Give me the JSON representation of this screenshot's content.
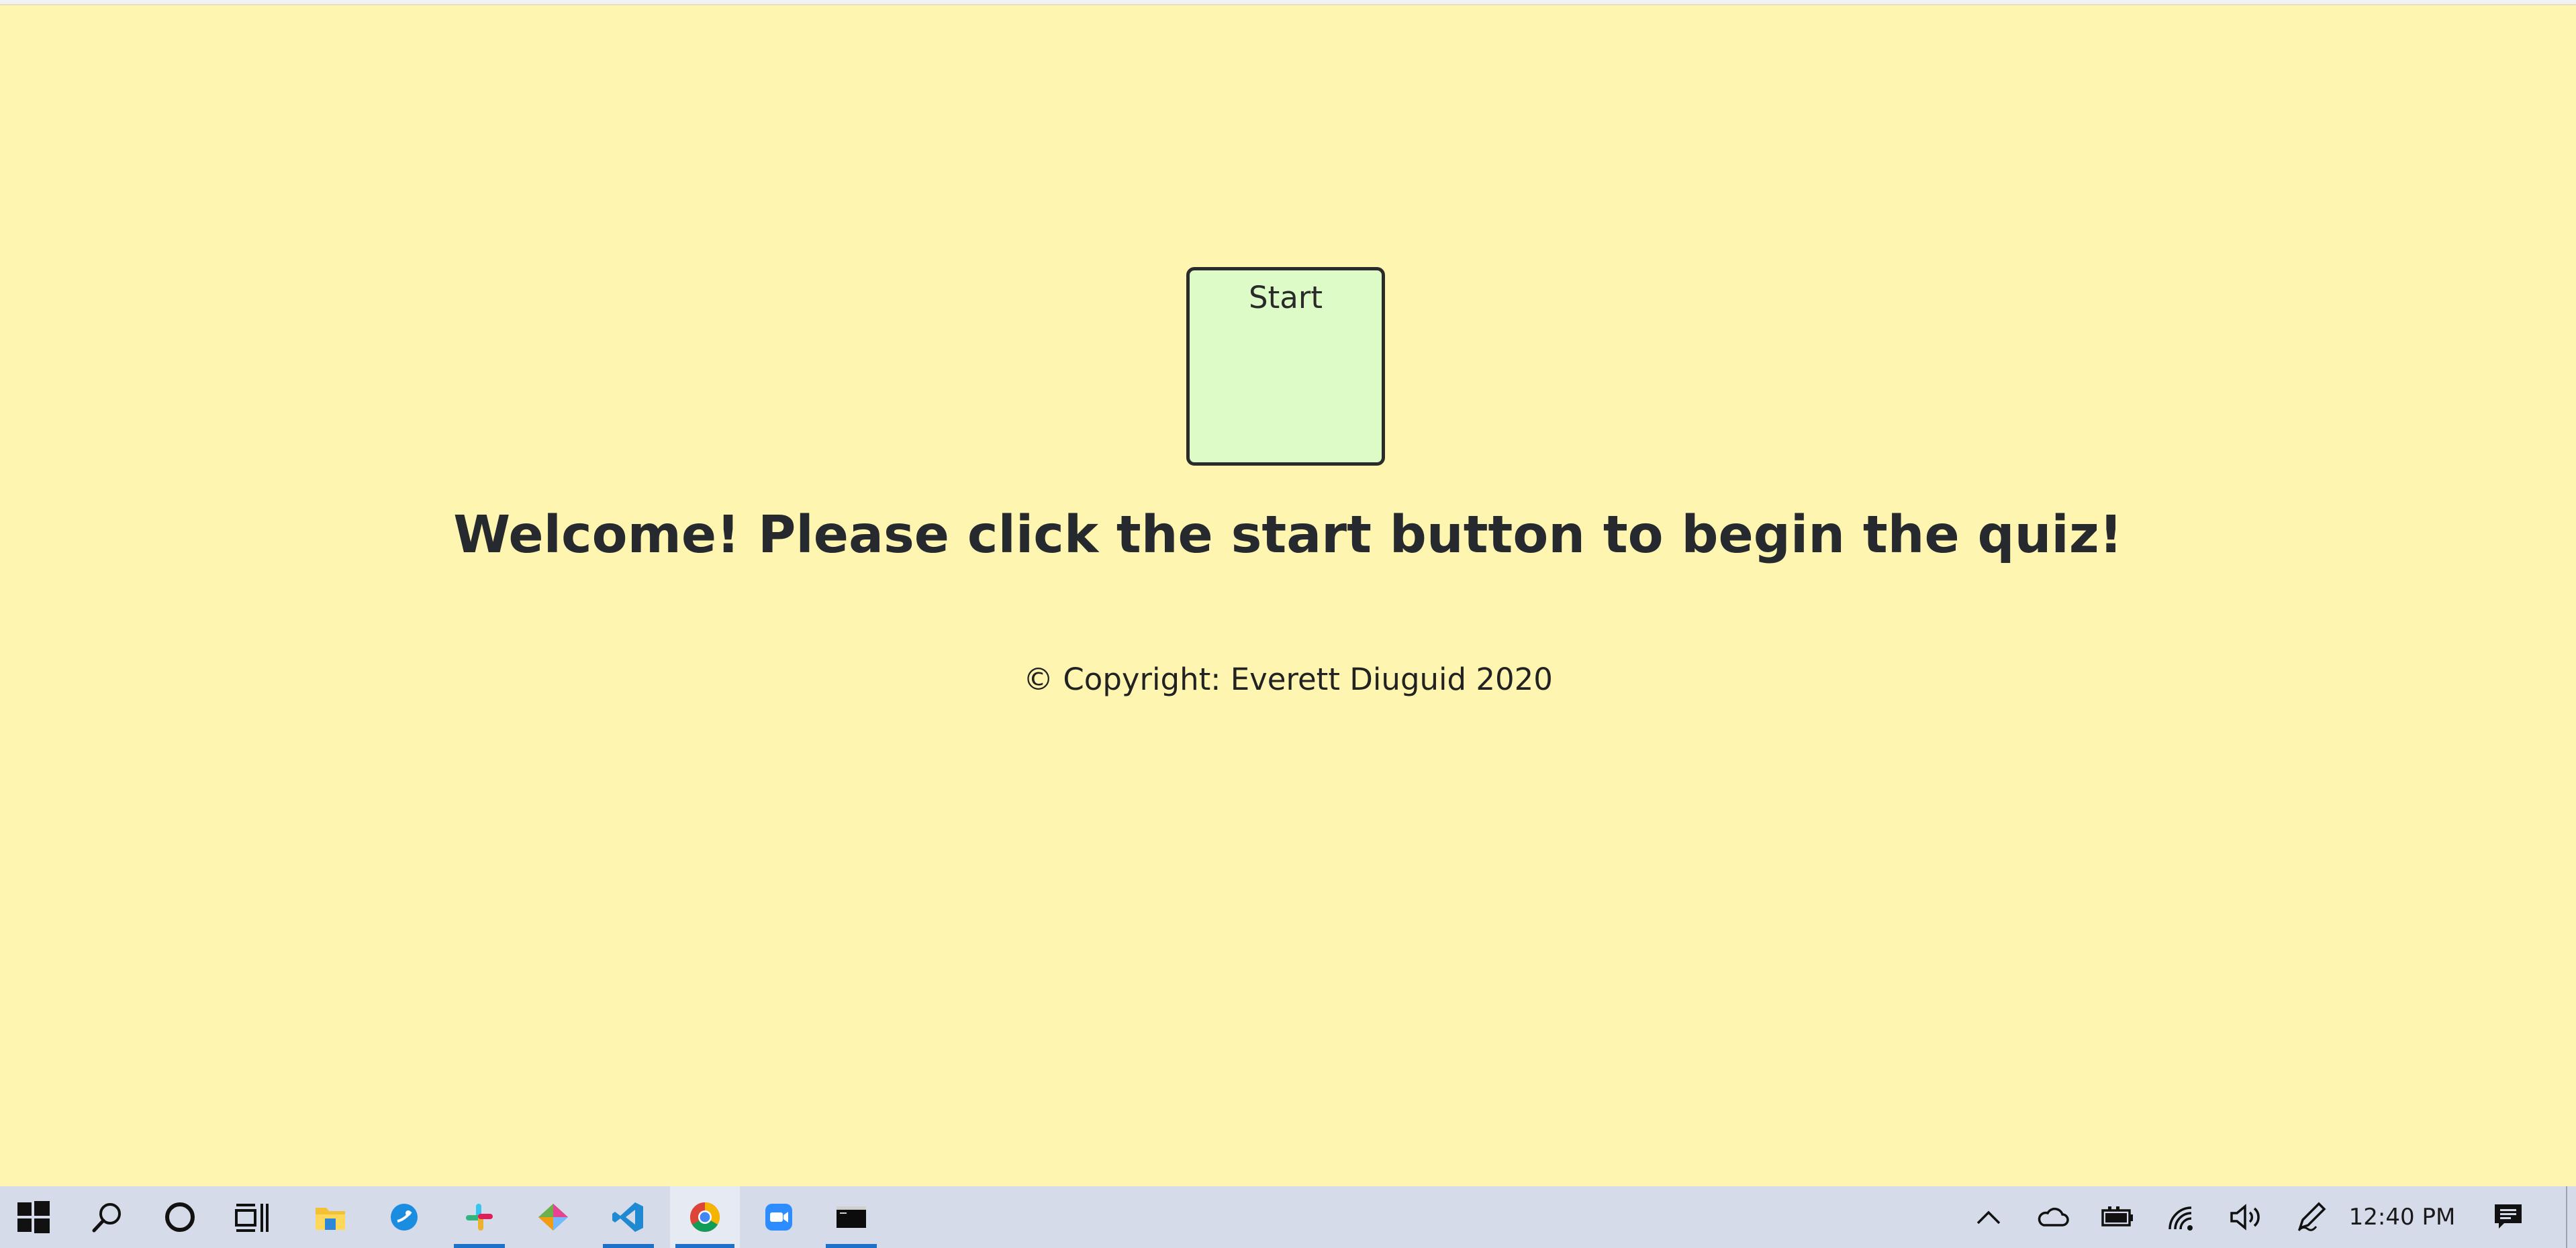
{
  "page": {
    "start_label": "Start",
    "welcome": "Welcome! Please click the start button to begin the quiz!",
    "copyright": "© Copyright: Everett Diuguid 2020"
  },
  "colors": {
    "background": "#fef5b0",
    "start_button": "#dcfbc7",
    "taskbar": "#d5dbe9",
    "active_indicator": "#1c72c9"
  },
  "taskbar": {
    "apps": [
      {
        "icon": "windows-start-icon",
        "running": false
      },
      {
        "icon": "search-icon",
        "running": false
      },
      {
        "icon": "cortana-icon",
        "running": false
      },
      {
        "icon": "task-view-icon",
        "running": false
      },
      {
        "icon": "file-explorer-icon",
        "running": false
      },
      {
        "icon": "ubiquiti-icon",
        "running": false
      },
      {
        "icon": "slack-icon",
        "running": true
      },
      {
        "icon": "gitkraken-icon",
        "running": false
      },
      {
        "icon": "vscode-icon",
        "running": true
      },
      {
        "icon": "chrome-icon",
        "running": true,
        "active": true
      },
      {
        "icon": "zoom-icon",
        "running": false
      },
      {
        "icon": "terminal-icon",
        "running": true
      }
    ],
    "tray": [
      "chevron-up-icon",
      "onedrive-icon",
      "battery-icon",
      "wifi-icon",
      "volume-icon",
      "pen-icon"
    ],
    "clock": "12:40 PM",
    "notification_icon": "action-center-icon"
  }
}
